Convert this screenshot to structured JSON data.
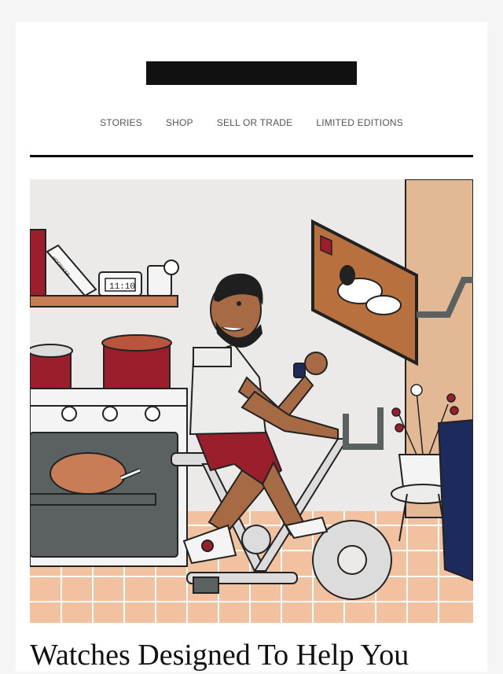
{
  "nav": {
    "items": [
      {
        "label": "STORIES"
      },
      {
        "label": "SHOP"
      },
      {
        "label": "SELL OR TRADE"
      },
      {
        "label": "LIMITED EDITIONS"
      }
    ]
  },
  "hero": {
    "illustration": "man-on-exercise-bike-kitchen",
    "clock_text": "11:10",
    "book_spine_text": "HODINKEE"
  },
  "article": {
    "headline": "Watches Designed To Help You"
  },
  "colors": {
    "background": "#f5f5f5",
    "card": "#ffffff",
    "rule": "#000000",
    "nav_text": "#555555",
    "headline_text": "#111111",
    "accent_red": "#9b1e2c",
    "accent_navy": "#1c2a5c",
    "tile_peach": "#f2c2a0"
  }
}
